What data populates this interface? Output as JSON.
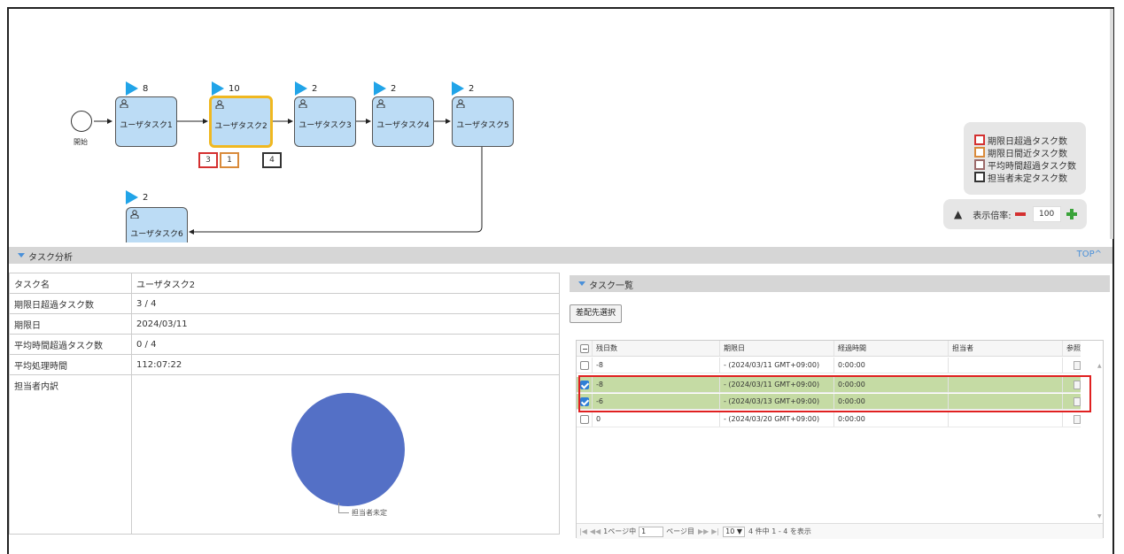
{
  "diagram": {
    "start_label": "開始",
    "tasks": [
      {
        "label": "ユーザタスク1",
        "count": "8"
      },
      {
        "label": "ユーザタスク2",
        "count": "10"
      },
      {
        "label": "ユーザタスク3",
        "count": "2"
      },
      {
        "label": "ユーザタスク4",
        "count": "2"
      },
      {
        "label": "ユーザタスク5",
        "count": "2"
      },
      {
        "label": "ユーザタスク6",
        "count": "2"
      }
    ],
    "task2_badges": [
      "3",
      "1",
      "4"
    ],
    "badge_colors": {
      "overdue": "#d43030",
      "near_due": "#d98a3a",
      "avg_over": "#9b6a6a",
      "unassigned": "#333333"
    },
    "selected_border_color": "#f0b820"
  },
  "legend": {
    "items": [
      "期限日超過タスク数",
      "期限日間近タスク数",
      "平均時間超過タスク数",
      "担当者未定タスク数"
    ]
  },
  "zoom": {
    "label": "表示倍率:",
    "value": "100"
  },
  "analysis": {
    "title": "タスク分析",
    "top_link": "TOP",
    "rows": [
      {
        "key": "タスク名",
        "value": "ユーザタスク2"
      },
      {
        "key": "期限日超過タスク数",
        "value": "3 / 4"
      },
      {
        "key": "期限日",
        "value": "2024/03/11"
      },
      {
        "key": "平均時間超過タスク数",
        "value": "0 / 4"
      },
      {
        "key": "平均処理時間",
        "value": "112:07:22"
      },
      {
        "key": "担当者内訳",
        "value": ""
      }
    ],
    "pie": {
      "label": "担当者未定",
      "color": "#5470c6"
    }
  },
  "task_list": {
    "title": "タスク一覧",
    "assign_button": "差配先選択",
    "columns": [
      "残日数",
      "期限日",
      "経過時間",
      "担当者",
      "参照"
    ],
    "rows": [
      {
        "checked": false,
        "days": "-8",
        "due": "- (2024/03/11 GMT+09:00)",
        "elapsed": "0:00:00",
        "assignee": ""
      },
      {
        "checked": true,
        "days": "-8",
        "due": "- (2024/03/11 GMT+09:00)",
        "elapsed": "0:00:00",
        "assignee": ""
      },
      {
        "checked": true,
        "days": "-6",
        "due": "- (2024/03/13 GMT+09:00)",
        "elapsed": "0:00:00",
        "assignee": ""
      },
      {
        "checked": false,
        "days": "0",
        "due": "- (2024/03/20 GMT+09:00)",
        "elapsed": "0:00:00",
        "assignee": ""
      }
    ],
    "pager": {
      "prefix": "1ページ中",
      "page": "1",
      "suffix": "ページ目",
      "per_page": "10",
      "summary": "4 件中 1 - 4 を表示"
    }
  }
}
